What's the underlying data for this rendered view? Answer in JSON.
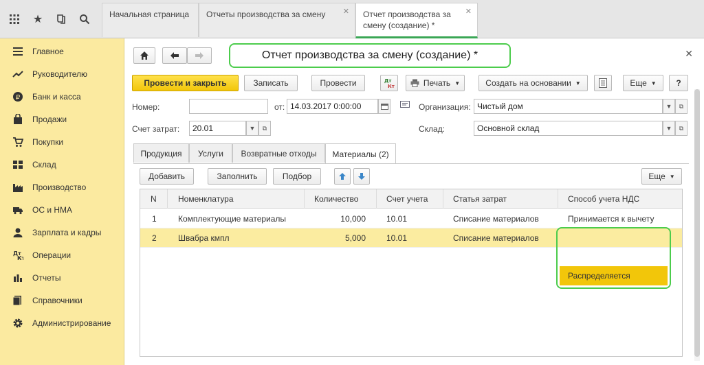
{
  "tabs": [
    {
      "label": "Начальная страница"
    },
    {
      "label": "Отчеты производства за смену"
    },
    {
      "label": "Отчет производства за смену (создание) *"
    }
  ],
  "sidebar": {
    "items": [
      {
        "label": "Главное",
        "icon": "menu-icon"
      },
      {
        "label": "Руководителю",
        "icon": "trend-icon"
      },
      {
        "label": "Банк и касса",
        "icon": "ruble-icon"
      },
      {
        "label": "Продажи",
        "icon": "bag-icon"
      },
      {
        "label": "Покупки",
        "icon": "cart-icon"
      },
      {
        "label": "Склад",
        "icon": "warehouse-icon"
      },
      {
        "label": "Производство",
        "icon": "factory-icon"
      },
      {
        "label": "ОС и НМА",
        "icon": "truck-icon"
      },
      {
        "label": "Зарплата и кадры",
        "icon": "person-icon"
      },
      {
        "label": "Операции",
        "icon": "operations-icon"
      },
      {
        "label": "Отчеты",
        "icon": "chart-icon"
      },
      {
        "label": "Справочники",
        "icon": "book-icon"
      },
      {
        "label": "Администрирование",
        "icon": "gear-icon"
      }
    ]
  },
  "document": {
    "title": "Отчет производства за смену (создание) *",
    "toolbar": {
      "post_close": "Провести и закрыть",
      "save": "Записать",
      "post": "Провести",
      "dtkt": "Дт Кт",
      "print": "Печать",
      "create_based": "Создать на основании",
      "more": "Еще",
      "help": "?"
    },
    "fields": {
      "number_label": "Номер:",
      "number_value": "",
      "from_label": "от:",
      "date_value": "14.03.2017  0:00:00",
      "org_label": "Организация:",
      "org_value": "Чистый дом",
      "account_label": "Счет затрат:",
      "account_value": "20.01",
      "warehouse_label": "Склад:",
      "warehouse_value": "Основной склад"
    },
    "tabs": [
      {
        "label": "Продукция"
      },
      {
        "label": "Услуги"
      },
      {
        "label": "Возвратные отходы"
      },
      {
        "label": "Материалы (2)"
      }
    ],
    "table_toolbar": {
      "add": "Добавить",
      "fill": "Заполнить",
      "pick": "Подбор",
      "more": "Еще"
    },
    "table": {
      "columns": [
        "N",
        "Номенклатура",
        "Количество",
        "Счет учета",
        "Статья затрат",
        "Способ учета НДС"
      ],
      "rows": [
        [
          "1",
          "Комплектующие материалы",
          "10,000",
          "10.01",
          "Списание материалов",
          "Принимается к вычету"
        ],
        [
          "2",
          "Швабра кмпл",
          "5,000",
          "10.01",
          "Списание материалов",
          "Распределяется"
        ]
      ]
    }
  },
  "colors": {
    "accent_green": "#4ccc4c",
    "sidebar_bg": "#fbeaa0",
    "primary_button": "#f2c60a"
  }
}
